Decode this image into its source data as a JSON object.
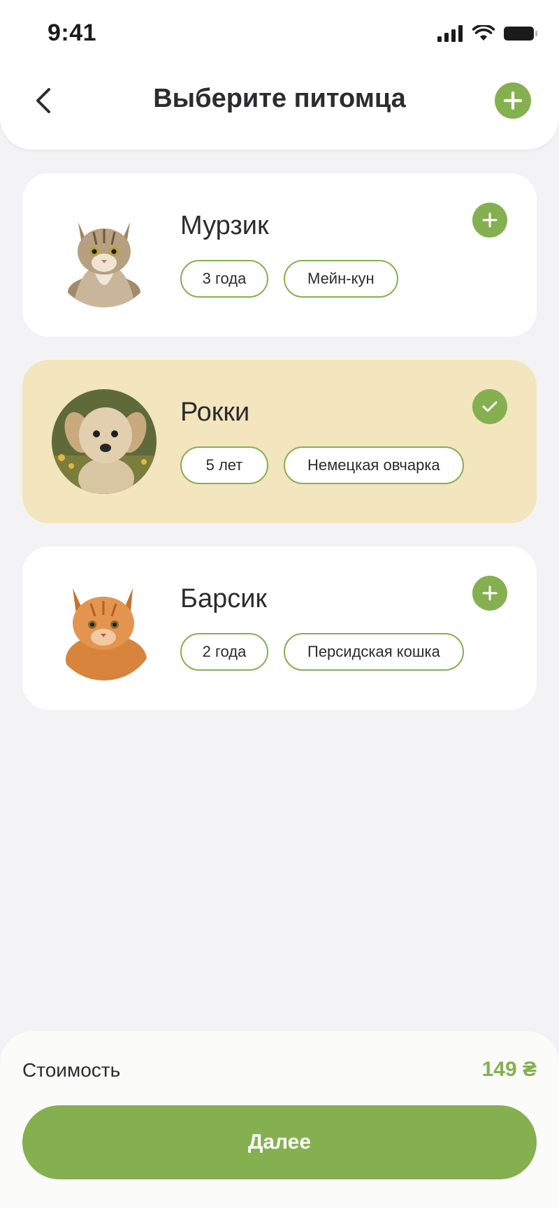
{
  "status_bar": {
    "time": "9:41"
  },
  "header": {
    "title": "Выберите питомца"
  },
  "pets": [
    {
      "name": "Мурзик",
      "age": "3 года",
      "breed": "Мейн-кун",
      "selected": false
    },
    {
      "name": "Рокки",
      "age": "5 лет",
      "breed": "Немецкая овчарка",
      "selected": true
    },
    {
      "name": "Барсик",
      "age": "2 года",
      "breed": "Персидская кошка",
      "selected": false
    }
  ],
  "footer": {
    "cost_label": "Стоимость",
    "cost_value": "149 ₴",
    "next_label": "Далее"
  },
  "colors": {
    "accent": "#85b050",
    "selected_card": "#f3e5bd",
    "background": "#f3f3f6"
  }
}
